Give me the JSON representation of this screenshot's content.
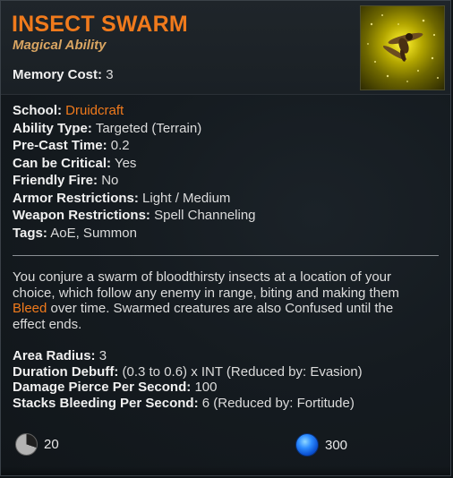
{
  "ability": {
    "title": "INSECT SWARM",
    "subtitle": "Magical Ability",
    "memory_cost_label": "Memory Cost:",
    "memory_cost_value": "3"
  },
  "stats": [
    {
      "label": "School:",
      "value": "Druidcraft"
    },
    {
      "label": "Ability Type:",
      "value": "Targeted (Terrain)"
    },
    {
      "label": "Pre-Cast Time:",
      "value": "0.2"
    },
    {
      "label": "Can be Critical:",
      "value": "Yes"
    },
    {
      "label": "Friendly Fire:",
      "value": "No"
    },
    {
      "label": "Armor Restrictions:",
      "value": "Light / Medium"
    },
    {
      "label": "Weapon Restrictions:",
      "value": "Spell Channeling"
    },
    {
      "label": "Tags:",
      "value": "AoE, Summon"
    }
  ],
  "description": {
    "line1": "You conjure a swarm of bloodthirsty insects at a location of your",
    "line2": "choice, which follow any enemy in range, biting and making them",
    "bleed": "Bleed",
    "line3_rest": " over time. Swarmed creatures are also Confused until the",
    "line4": "effect ends."
  },
  "details": [
    {
      "label": "Area Radius:",
      "value": "3"
    },
    {
      "label": "Duration Debuff:",
      "value": "(0.3 to 0.6) x INT (Reduced by: Evasion)"
    },
    {
      "label": "Damage Pierce Per Second:",
      "value": "100"
    },
    {
      "label": "Stacks Bleeding Per Second:",
      "value": "6 (Reduced by: Fortitude)"
    }
  ],
  "footer": {
    "cooldown_value": "20",
    "mana_value": "300"
  },
  "colors": {
    "accent": "#f07a1c",
    "subtitle": "#d9a562",
    "mana": "#2d8cff"
  },
  "icons": {
    "portrait": "insect-swarm-icon",
    "cooldown": "cooldown-icon",
    "mana": "mana-icon"
  }
}
